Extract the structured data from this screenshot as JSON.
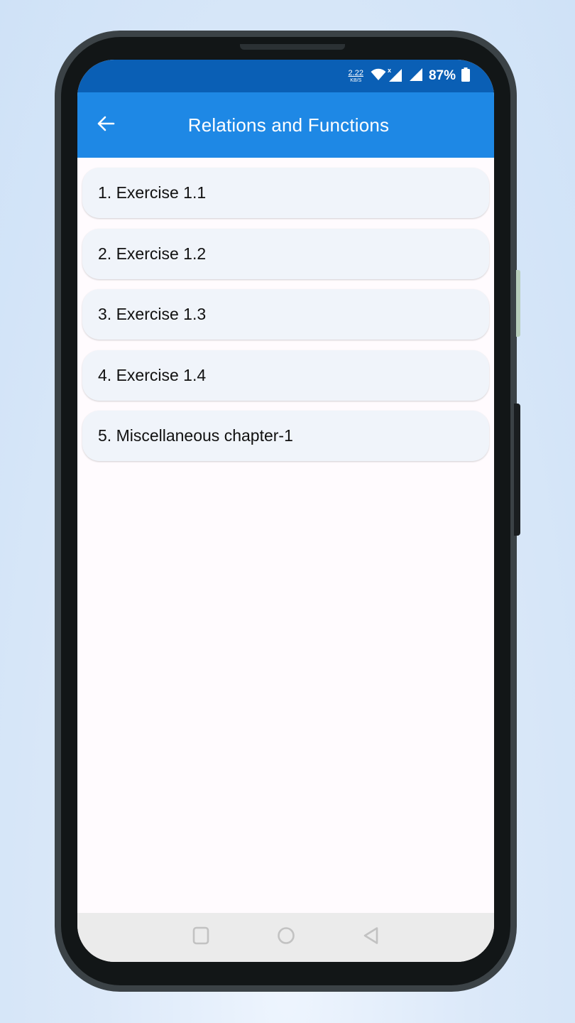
{
  "status_bar": {
    "net_speed_value": "2.22",
    "net_speed_unit": "KB/S",
    "battery_percent": "87%",
    "icons": [
      "wifi-icon",
      "cell-signal-no-data-icon",
      "cell-signal-icon",
      "battery-icon"
    ]
  },
  "app_bar": {
    "title": "Relations and Functions",
    "back_icon": "arrow-left-icon"
  },
  "list": {
    "items": [
      {
        "label": "1. Exercise 1.1"
      },
      {
        "label": "2. Exercise 1.2"
      },
      {
        "label": "3. Exercise 1.3"
      },
      {
        "label": "4. Exercise 1.4"
      },
      {
        "label": "5. Miscellaneous chapter-1"
      }
    ]
  },
  "nav_bar": {
    "buttons": [
      "recents-icon",
      "home-icon",
      "back-icon"
    ]
  },
  "colors": {
    "status_bar": "#0a5fb5",
    "app_bar": "#1e88e5",
    "list_item_bg": "#f0f4fa",
    "screen_bg": "#fffbfe",
    "nav_bar_bg": "#ebebeb"
  }
}
